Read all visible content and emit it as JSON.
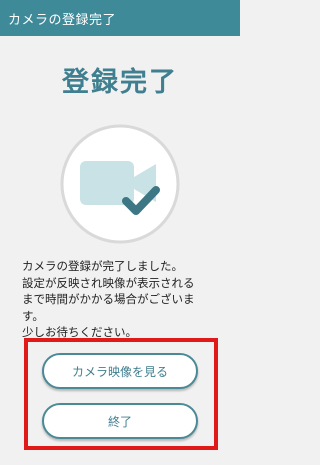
{
  "header": {
    "title": "カメラの登録完了"
  },
  "main": {
    "title": "登録完了",
    "message_lines": [
      "カメラの登録が完了しました。",
      "設定が反映され映像が表示される",
      "まで時間がかかる場合がございま",
      "す。",
      "少しお待ちください。"
    ]
  },
  "buttons": {
    "view_camera": "カメラ映像を見る",
    "finish": "終了"
  },
  "colors": {
    "header_bg": "#3f8a98",
    "accent": "#3f7f8f",
    "illustration_light": "#c9e2e6",
    "check": "#3d7684",
    "highlight": "#e01919"
  },
  "icons": {
    "illustration": "camera-check-icon"
  }
}
